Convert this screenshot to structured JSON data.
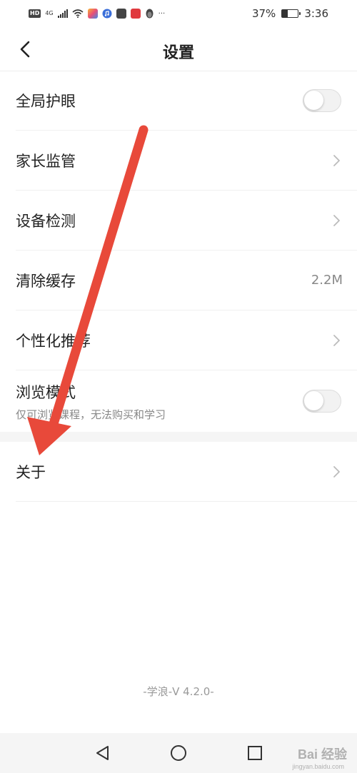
{
  "status_bar": {
    "badge": "HD",
    "network": "4G",
    "more": "···",
    "battery_percent": "37%",
    "battery_level": 0.37,
    "time": "3:36"
  },
  "header": {
    "title": "设置"
  },
  "settings": [
    {
      "label": "全局护眼",
      "control": "toggle",
      "on": false
    },
    {
      "label": "家长监管",
      "control": "chevron"
    },
    {
      "label": "设备检测",
      "control": "chevron"
    },
    {
      "label": "清除缓存",
      "control": "value",
      "value": "2.2M"
    },
    {
      "label": "个性化推荐",
      "control": "chevron"
    },
    {
      "label": "浏览模式",
      "sublabel": "仅可浏览课程，无法购买和学习",
      "control": "toggle",
      "on": false
    }
  ],
  "about": {
    "label": "关于",
    "control": "chevron"
  },
  "footer": {
    "version": "-学浪-V 4.2.0-"
  },
  "watermark": {
    "text": "Bai 经验",
    "sub": "jingyan.baidu.com"
  },
  "colors": {
    "annotation_arrow": "#e8493a",
    "toggle_off": "#f2f2f2"
  }
}
